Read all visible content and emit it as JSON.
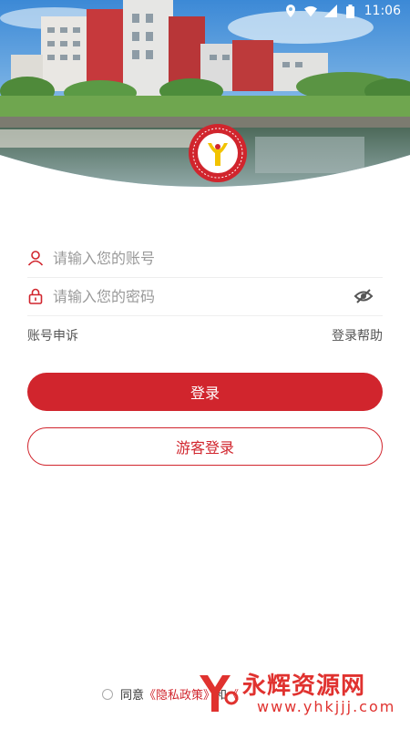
{
  "status_bar": {
    "time": "11:06"
  },
  "login": {
    "account_placeholder": "请输入您的账号",
    "password_placeholder": "请输入您的密码",
    "account_appeal": "账号申诉",
    "login_help": "登录帮助",
    "login_button": "登录",
    "guest_login_button": "游客登录"
  },
  "agreement": {
    "prefix": "同意",
    "privacy_link": "《隐私政策》",
    "and": "和",
    "terms_link": "《"
  },
  "watermark": {
    "brand": "永辉资源网",
    "url": "www.yhkjjj.com"
  },
  "colors": {
    "brand_red": "#d1252d"
  },
  "icons": [
    "location-icon",
    "wifi-icon",
    "signal-icon",
    "battery-icon",
    "user-icon",
    "lock-icon",
    "eye-off-icon"
  ]
}
